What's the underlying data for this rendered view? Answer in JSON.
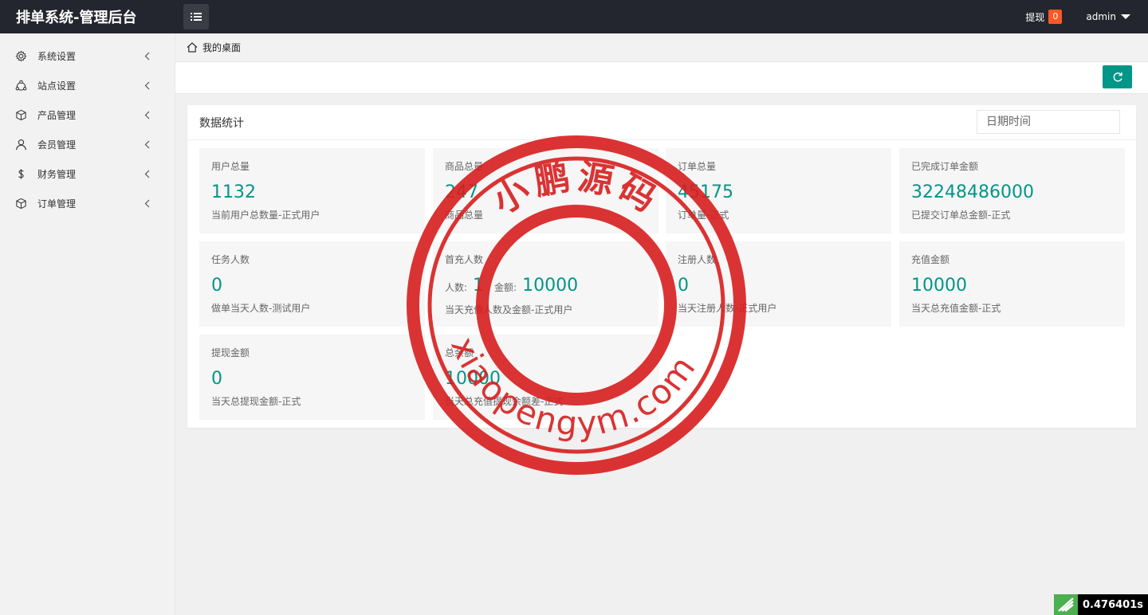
{
  "header": {
    "title": "排单系统-管理后台",
    "withdraw_label": "提现",
    "withdraw_count": "0",
    "user_name": "admin"
  },
  "sidebar": {
    "items": [
      {
        "label": "系统设置",
        "icon": "gear-icon"
      },
      {
        "label": "站点设置",
        "icon": "site-icon"
      },
      {
        "label": "产品管理",
        "icon": "box-icon"
      },
      {
        "label": "会员管理",
        "icon": "user-icon"
      },
      {
        "label": "财务管理",
        "icon": "dollar-icon"
      },
      {
        "label": "订单管理",
        "icon": "box-icon"
      }
    ]
  },
  "breadcrumb": {
    "label": "我的桌面"
  },
  "panel": {
    "title": "数据统计",
    "date_placeholder": "日期时间"
  },
  "cards": [
    {
      "title": "用户总量",
      "value": "1132",
      "desc": "当前用户总数量-正式用户"
    },
    {
      "title": "商品总量",
      "value": "247",
      "desc": "商品总量"
    },
    {
      "title": "订单总量",
      "value": "45175",
      "desc": "订单量-正式"
    },
    {
      "title": "已完成订单金额",
      "value": "32248486000",
      "desc": "已提交订单总金额-正式"
    },
    {
      "title": "任务人数",
      "value": "0",
      "desc": "做单当天人数-测试用户"
    },
    {
      "title": "首充人数",
      "count_label": "人数:",
      "count": "1",
      "amount_label": "金额:",
      "amount": "10000",
      "desc": "当天充值人数及金额-正式用户"
    },
    {
      "title": "注册人数",
      "value": "0",
      "desc": "当天注册人数-正式用户"
    },
    {
      "title": "充值金额",
      "value": "10000",
      "desc": "当天总充值金额-正式"
    },
    {
      "title": "提现金额",
      "value": "0",
      "desc": "当天总提现金额-正式"
    },
    {
      "title": "总余额",
      "value": "10000",
      "desc": "当天总充值提现余额差-正式"
    }
  ],
  "stamp": {
    "top_text": "小鹏源码",
    "bottom_text": "xiaopengym.com",
    "color": "#d81e1e"
  },
  "timer": {
    "value": "0.476401s"
  },
  "colors": {
    "accent": "#009688",
    "badge": "#ff5722",
    "topbar": "#23262e"
  }
}
